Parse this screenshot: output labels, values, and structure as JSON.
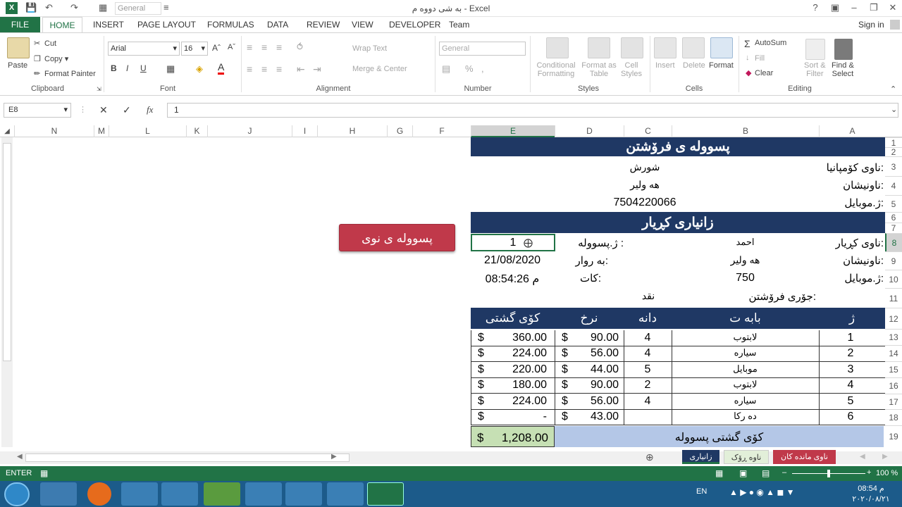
{
  "window": {
    "title": "به شى دووه م - Excel",
    "help": "?",
    "sign_in": "Sign in",
    "team_tab": "Team"
  },
  "qat": {
    "number_format": "General"
  },
  "tabs": [
    "FILE",
    "HOME",
    "INSERT",
    "PAGE LAYOUT",
    "FORMULAS",
    "DATA",
    "REVIEW",
    "VIEW",
    "DEVELOPER",
    "Team"
  ],
  "ribbon": {
    "clipboard": {
      "paste": "Paste",
      "cut": "Cut",
      "copy": "Copy",
      "format_painter": "Format Painter",
      "label": "Clipboard"
    },
    "font": {
      "name": "Arial",
      "size": "16",
      "bold": "B",
      "italic": "I",
      "underline": "U",
      "label": "Font"
    },
    "alignment": {
      "wrap": "Wrap Text",
      "merge": "Merge & Center",
      "label": "Alignment"
    },
    "number": {
      "format": "General",
      "label": "Number"
    },
    "styles": {
      "cond1": "Conditional",
      "cond2": "Formatting",
      "fmt1": "Format as",
      "fmt2": "Table",
      "cell1": "Cell",
      "cell2": "Styles",
      "label": "Styles"
    },
    "cells": {
      "insert": "Insert",
      "delete": "Delete",
      "format": "Format",
      "label": "Cells"
    },
    "editing": {
      "autosum": "AutoSum",
      "fill": "Fill",
      "clear": "Clear",
      "sort1": "Sort &",
      "sort2": "Filter",
      "find1": "Find &",
      "find2": "Select",
      "label": "Editing"
    }
  },
  "formula_bar": {
    "name_box": "E8",
    "value": "1",
    "fx": "fx"
  },
  "columns": [
    "N",
    "M",
    "L",
    "K",
    "J",
    "I",
    "H",
    "G",
    "F",
    "E",
    "D",
    "C",
    "B",
    "A"
  ],
  "rows": [
    "1",
    "2",
    "3",
    "4",
    "5",
    "6",
    "7",
    "8",
    "9",
    "10",
    "11",
    "12",
    "13",
    "14",
    "15",
    "16",
    "17",
    "18",
    "19"
  ],
  "invoice": {
    "title": "پسووله ى فرۆشتن",
    "company_label": "ناوى کۆمپانیا:",
    "company": "شورش",
    "address_label": "ناونیشان:",
    "address": "هه ولیر",
    "mobile_label": "ژ.موبایل:",
    "mobile": "7504220066",
    "buyer_title": "زانیارى کڕیار",
    "buyer_label": "ناوى کڕیار:",
    "buyer": "احمد",
    "inv_no_label": "ژ.پسووله :",
    "inv_no": "1",
    "buyer_addr_label": "ناونیشان:",
    "buyer_addr": "هه ولیر",
    "date_label": "به روار:",
    "date": "21/08/2020",
    "buyer_mobile_label": "ژ.موبایل:",
    "buyer_mobile": "750",
    "time_label": "کات:",
    "time": "08:54:26 م",
    "sale_type_label": "جۆرى فرۆشتن:",
    "sale_type": "نقد",
    "headers": {
      "no": "ژ",
      "item": "بابه ت",
      "qty": "دانه",
      "price": "نرخ",
      "total": "کۆى گشتى"
    },
    "items": [
      {
        "no": "1",
        "item": "لابتوب",
        "qty": "4",
        "price": "90.00",
        "total": "360.00"
      },
      {
        "no": "2",
        "item": "سیاره",
        "qty": "4",
        "price": "56.00",
        "total": "224.00"
      },
      {
        "no": "3",
        "item": "موبایل",
        "qty": "5",
        "price": "44.00",
        "total": "220.00"
      },
      {
        "no": "4",
        "item": "لابتوب",
        "qty": "2",
        "price": "90.00",
        "total": "180.00"
      },
      {
        "no": "5",
        "item": "سیاره",
        "qty": "4",
        "price": "56.00",
        "total": "224.00"
      },
      {
        "no": "6",
        "item": "ده رکا",
        "qty": "",
        "price": "43.00",
        "total": "-"
      }
    ],
    "currency": "$",
    "grand_label": "کۆى گشتى پسووله",
    "grand_total": "1,208.00"
  },
  "new_invoice_button": "پسووله ى نوى",
  "sheet_tabs": [
    "ناوى مانده کان",
    "ناوه ڕۆک",
    "زانيارى"
  ],
  "status": {
    "mode": "ENTER",
    "zoom": "100 %"
  },
  "taskbar": {
    "lang": "EN",
    "time": "08:54 م",
    "date": "٢٠٢٠/٠٨/٢١"
  },
  "colors": {
    "accent": "#217346",
    "navy": "#1f3864",
    "button": "#c0394a",
    "light_blue": "#b4c7e7"
  }
}
